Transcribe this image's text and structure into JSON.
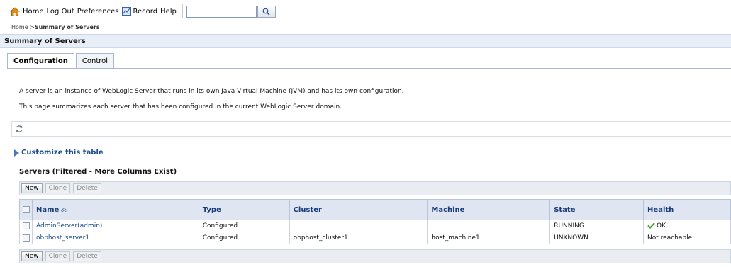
{
  "nav": {
    "home": "Home",
    "logout": "Log Out",
    "preferences": "Preferences",
    "record": "Record",
    "help": "Help",
    "search_value": ""
  },
  "breadcrumb": {
    "home": "Home",
    "separator": " >",
    "current": "Summary of Servers"
  },
  "page": {
    "title": "Summary of Servers"
  },
  "tabs": [
    {
      "label": "Configuration",
      "active": true
    },
    {
      "label": "Control",
      "active": false
    }
  ],
  "description": {
    "line1": "A server is an instance of WebLogic Server that runs in its own Java Virtual Machine (JVM) and has its own configuration.",
    "line2": "This page summarizes each server that has been configured in the current WebLogic Server domain."
  },
  "customize": {
    "label": "Customize this table"
  },
  "table": {
    "caption": "Servers (Filtered - More Columns Exist)",
    "buttons": {
      "new": "New",
      "clone": "Clone",
      "delete": "Delete"
    },
    "columns": {
      "name": "Name",
      "type": "Type",
      "cluster": "Cluster",
      "machine": "Machine",
      "state": "State",
      "health": "Health"
    },
    "rows": [
      {
        "name": "AdminServer(admin)",
        "type": "Configured",
        "cluster": "",
        "machine": "",
        "state": "RUNNING",
        "health": "OK"
      },
      {
        "name": "obphost_server1",
        "type": "Configured",
        "cluster": "obphost_cluster1",
        "machine": "host_machine1",
        "state": "UNKNOWN",
        "health": "Not reachable"
      }
    ]
  },
  "colors": {
    "link": "#1a4b8c",
    "header_text": "#1a3c7a",
    "header_bg": "#dfe6f2",
    "ok_green": "#3c9a2f"
  }
}
